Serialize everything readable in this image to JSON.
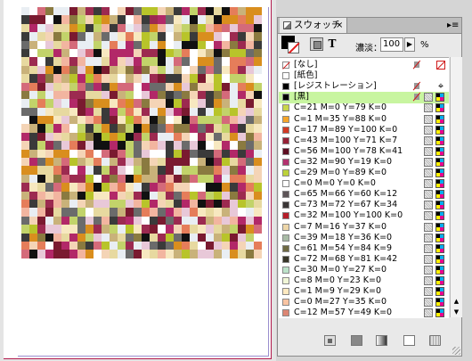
{
  "mosaic_palette": [
    "#e8c8d8",
    "#f7e8c0",
    "#b22868",
    "#7a1a30",
    "#b8c42a",
    "#e7d9a0",
    "#ffffff",
    "#111111",
    "#d98e1e",
    "#c2d36a",
    "#f2b5a0",
    "#6b6b6b",
    "#d46a7a",
    "#e9eef3",
    "#9c2a50",
    "#f4d4b6",
    "#3a3a3a",
    "#c9b27a",
    "#e57d5a",
    "#8a7a40"
  ],
  "panel": {
    "tab_label": "スウォッチ",
    "close_glyph": "×",
    "menu_glyph": "▸≡",
    "tint_label": "濃淡：",
    "tint_value": "100",
    "tint_arrow": "▶",
    "tint_unit": "%",
    "text_button": "T"
  },
  "swatches": [
    {
      "name": "[なし]",
      "chip": "none",
      "type": "none",
      "locked": true
    },
    {
      "name": "[紙色]",
      "chip": "white",
      "type": "",
      "locked": false
    },
    {
      "name": "[レジストレーション]",
      "chip": "reg",
      "type": "registration",
      "locked": true
    },
    {
      "name": "[黒]",
      "chip": "#000000",
      "type": "process",
      "locked": true,
      "selected": true
    },
    {
      "name": "C=21 M=0 Y=79 K=0",
      "chip": "#c9d64a",
      "type": "process"
    },
    {
      "name": "C=1 M=35 Y=88 K=0",
      "chip": "#f5a52a",
      "type": "process"
    },
    {
      "name": "C=17 M=89 Y=100 K=0",
      "chip": "#d13a24",
      "type": "process"
    },
    {
      "name": "C=43 M=100 Y=71 K=7",
      "chip": "#962136",
      "type": "process"
    },
    {
      "name": "C=56 M=100 Y=78 K=41",
      "chip": "#5e0f22",
      "type": "process"
    },
    {
      "name": "C=32 M=90 Y=19 K=0",
      "chip": "#b3326f",
      "type": "process"
    },
    {
      "name": "C=29 M=0 Y=89 K=0",
      "chip": "#bcd23a",
      "type": "process"
    },
    {
      "name": "C=0 M=0 Y=0 K=0",
      "chip": "#ffffff",
      "type": "process"
    },
    {
      "name": "C=65 M=66 Y=60 K=12",
      "chip": "#5d5457",
      "type": "process"
    },
    {
      "name": "C=73 M=72 Y=67 K=34",
      "chip": "#3a3535",
      "type": "process"
    },
    {
      "name": "C=32 M=100 Y=100 K=0",
      "chip": "#b51e29",
      "type": "process"
    },
    {
      "name": "C=7 M=16 Y=37 K=0",
      "chip": "#edd6a8",
      "type": "process"
    },
    {
      "name": "C=39 M=18 Y=36 K=0",
      "chip": "#a8bba5",
      "type": "process"
    },
    {
      "name": "C=61 M=54 Y=84 K=9",
      "chip": "#6f6a43",
      "type": "process"
    },
    {
      "name": "C=72 M=68 Y=81 K=42",
      "chip": "#383628",
      "type": "process"
    },
    {
      "name": "C=30 M=0 Y=27 K=0",
      "chip": "#bce2c9",
      "type": "process"
    },
    {
      "name": "C=8 M=0 Y=23 K=0",
      "chip": "#f0f6d6",
      "type": "process"
    },
    {
      "name": "C=1 M=9 Y=29 K=0",
      "chip": "#fde9c0",
      "type": "process"
    },
    {
      "name": "C=0 M=27 Y=35 K=0",
      "chip": "#f9c4a2",
      "type": "process"
    },
    {
      "name": "C=12 M=57 Y=49 K=0",
      "chip": "#dc8572",
      "type": "process"
    }
  ]
}
